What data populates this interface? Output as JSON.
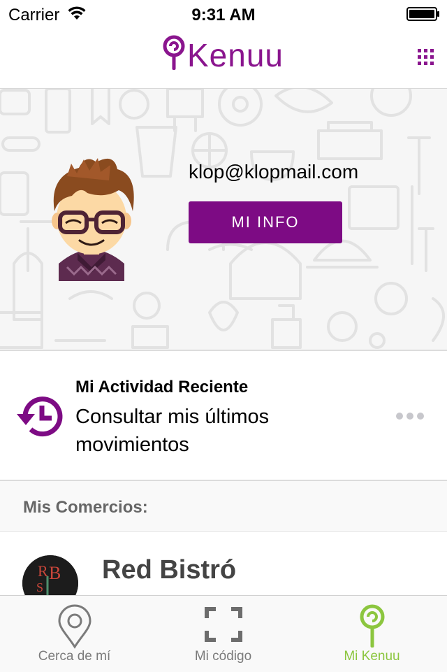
{
  "status_bar": {
    "carrier": "Carrier",
    "time": "9:31 AM"
  },
  "nav": {
    "logo_text": "Kenuu",
    "menu_icon": "grid-icon",
    "brand_color": "#8a158e"
  },
  "profile": {
    "email": "klop@klopmail.com",
    "info_button": "MI INFO",
    "button_color": "#7d0b84"
  },
  "activity": {
    "title": "Mi Actividad Reciente",
    "description": "Consultar mis últimos movimientos",
    "icon": "history-clock-icon",
    "more_icon": "more-dots-icon"
  },
  "stores": {
    "header": "Mis Comercios:",
    "items": [
      {
        "name": "Red Bistró",
        "logo_icon": "red-bistro-logo"
      }
    ]
  },
  "tabs": [
    {
      "label": "Cerca de mí",
      "icon": "location-pin-icon",
      "active": false
    },
    {
      "label": "Mi código",
      "icon": "scan-frame-icon",
      "active": false
    },
    {
      "label": "Mi Kenuu",
      "icon": "lollipop-icon",
      "active": true
    }
  ],
  "colors": {
    "active_tab": "#8cc63f",
    "inactive_tab": "#7b7b7b"
  }
}
